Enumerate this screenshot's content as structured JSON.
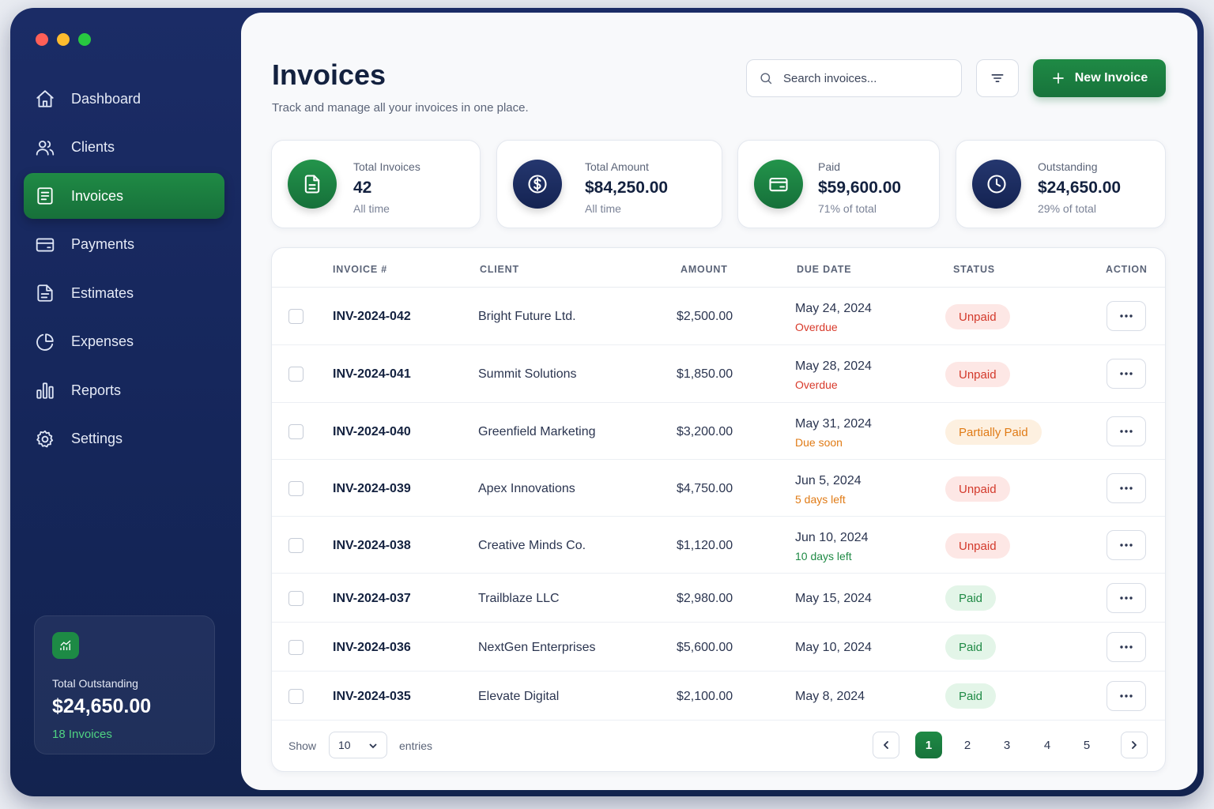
{
  "sidebar": {
    "items": [
      {
        "label": "Dashboard",
        "icon": "home-icon",
        "active": false
      },
      {
        "label": "Clients",
        "icon": "users-icon",
        "active": false
      },
      {
        "label": "Invoices",
        "icon": "document-icon",
        "active": true
      },
      {
        "label": "Payments",
        "icon": "credit-card-icon",
        "active": false
      },
      {
        "label": "Estimates",
        "icon": "file-text-icon",
        "active": false
      },
      {
        "label": "Expenses",
        "icon": "pie-chart-icon",
        "active": false
      },
      {
        "label": "Reports",
        "icon": "bar-chart-icon",
        "active": false
      },
      {
        "label": "Settings",
        "icon": "gear-icon",
        "active": false
      }
    ],
    "summary": {
      "label": "Total Outstanding",
      "value": "$24,650.00",
      "sub": "18 Invoices",
      "icon": "chart-up-icon"
    }
  },
  "header": {
    "title": "Invoices",
    "subtitle": "Track and manage all your invoices in one place.",
    "search_placeholder": "Search invoices...",
    "new_button": "New Invoice"
  },
  "stats": [
    {
      "label": "Total Invoices",
      "value": "42",
      "sub": "All time",
      "icon": "document-icon",
      "color": "green"
    },
    {
      "label": "Total Amount",
      "value": "$84,250.00",
      "sub": "All time",
      "icon": "dollar-coin-icon",
      "color": "navy"
    },
    {
      "label": "Paid",
      "value": "$59,600.00",
      "sub": "71% of total",
      "icon": "wallet-icon",
      "color": "green"
    },
    {
      "label": "Outstanding",
      "value": "$24,650.00",
      "sub": "29% of total",
      "icon": "clock-icon",
      "color": "navy"
    }
  ],
  "table": {
    "columns": {
      "invoice": "INVOICE #",
      "client": "CLIENT",
      "amount": "AMOUNT",
      "due": "DUE DATE",
      "status": "STATUS",
      "action": "ACTION"
    },
    "rows": [
      {
        "invoice": "INV-2024-042",
        "client": "Bright Future Ltd.",
        "amount": "$2,500.00",
        "due": "May 24, 2024",
        "due_note": "Overdue",
        "note_tone": "red",
        "status": "Unpaid",
        "status_tone": "unpaid"
      },
      {
        "invoice": "INV-2024-041",
        "client": "Summit Solutions",
        "amount": "$1,850.00",
        "due": "May 28, 2024",
        "due_note": "Overdue",
        "note_tone": "red",
        "status": "Unpaid",
        "status_tone": "unpaid"
      },
      {
        "invoice": "INV-2024-040",
        "client": "Greenfield Marketing",
        "amount": "$3,200.00",
        "due": "May 31, 2024",
        "due_note": "Due soon",
        "note_tone": "orange",
        "status": "Partially Paid",
        "status_tone": "partial"
      },
      {
        "invoice": "INV-2024-039",
        "client": "Apex Innovations",
        "amount": "$4,750.00",
        "due": "Jun 5, 2024",
        "due_note": "5 days left",
        "note_tone": "orange",
        "status": "Unpaid",
        "status_tone": "unpaid"
      },
      {
        "invoice": "INV-2024-038",
        "client": "Creative Minds Co.",
        "amount": "$1,120.00",
        "due": "Jun 10, 2024",
        "due_note": "10 days left",
        "note_tone": "green",
        "status": "Unpaid",
        "status_tone": "unpaid"
      },
      {
        "invoice": "INV-2024-037",
        "client": "Trailblaze LLC",
        "amount": "$2,980.00",
        "due": "May 15, 2024",
        "due_note": "",
        "note_tone": "",
        "status": "Paid",
        "status_tone": "paid"
      },
      {
        "invoice": "INV-2024-036",
        "client": "NextGen Enterprises",
        "amount": "$5,600.00",
        "due": "May 10, 2024",
        "due_note": "",
        "note_tone": "",
        "status": "Paid",
        "status_tone": "paid"
      },
      {
        "invoice": "INV-2024-035",
        "client": "Elevate Digital",
        "amount": "$2,100.00",
        "due": "May 8, 2024",
        "due_note": "",
        "note_tone": "",
        "status": "Paid",
        "status_tone": "paid"
      }
    ]
  },
  "footer": {
    "show_label": "Show",
    "entries_value": "10",
    "entries_label": "entries",
    "pages": [
      "1",
      "2",
      "3",
      "4",
      "5"
    ],
    "current_page": "1"
  },
  "colors": {
    "accent": "#1f8a45",
    "navy": "#15265a",
    "danger": "#d3392b",
    "warning": "#e07b16"
  }
}
